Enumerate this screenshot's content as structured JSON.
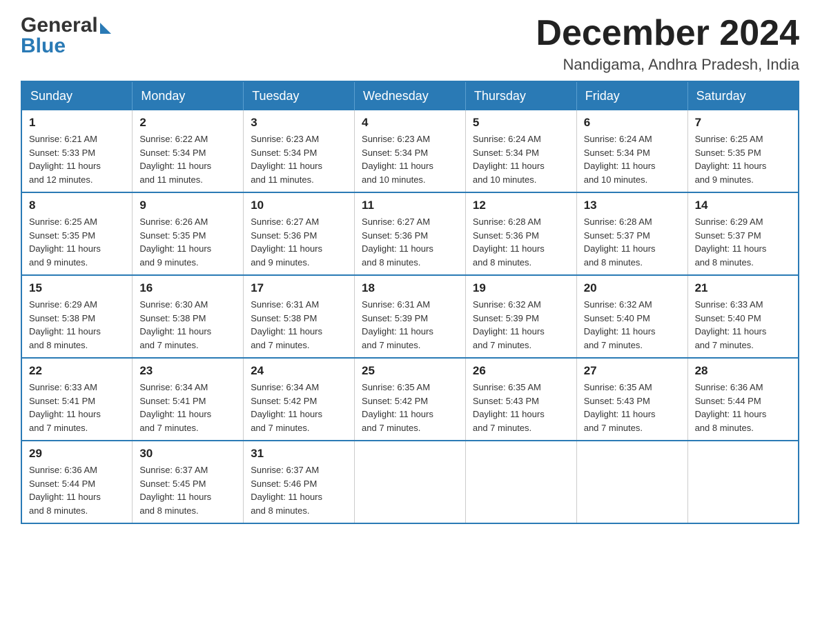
{
  "header": {
    "logo_general": "General",
    "logo_blue": "Blue",
    "month_title": "December 2024",
    "location": "Nandigama, Andhra Pradesh, India"
  },
  "days_of_week": [
    "Sunday",
    "Monday",
    "Tuesday",
    "Wednesday",
    "Thursday",
    "Friday",
    "Saturday"
  ],
  "weeks": [
    [
      {
        "day": "1",
        "sunrise": "6:21 AM",
        "sunset": "5:33 PM",
        "daylight": "11 hours and 12 minutes."
      },
      {
        "day": "2",
        "sunrise": "6:22 AM",
        "sunset": "5:34 PM",
        "daylight": "11 hours and 11 minutes."
      },
      {
        "day": "3",
        "sunrise": "6:23 AM",
        "sunset": "5:34 PM",
        "daylight": "11 hours and 11 minutes."
      },
      {
        "day": "4",
        "sunrise": "6:23 AM",
        "sunset": "5:34 PM",
        "daylight": "11 hours and 10 minutes."
      },
      {
        "day": "5",
        "sunrise": "6:24 AM",
        "sunset": "5:34 PM",
        "daylight": "11 hours and 10 minutes."
      },
      {
        "day": "6",
        "sunrise": "6:24 AM",
        "sunset": "5:34 PM",
        "daylight": "11 hours and 10 minutes."
      },
      {
        "day": "7",
        "sunrise": "6:25 AM",
        "sunset": "5:35 PM",
        "daylight": "11 hours and 9 minutes."
      }
    ],
    [
      {
        "day": "8",
        "sunrise": "6:25 AM",
        "sunset": "5:35 PM",
        "daylight": "11 hours and 9 minutes."
      },
      {
        "day": "9",
        "sunrise": "6:26 AM",
        "sunset": "5:35 PM",
        "daylight": "11 hours and 9 minutes."
      },
      {
        "day": "10",
        "sunrise": "6:27 AM",
        "sunset": "5:36 PM",
        "daylight": "11 hours and 9 minutes."
      },
      {
        "day": "11",
        "sunrise": "6:27 AM",
        "sunset": "5:36 PM",
        "daylight": "11 hours and 8 minutes."
      },
      {
        "day": "12",
        "sunrise": "6:28 AM",
        "sunset": "5:36 PM",
        "daylight": "11 hours and 8 minutes."
      },
      {
        "day": "13",
        "sunrise": "6:28 AM",
        "sunset": "5:37 PM",
        "daylight": "11 hours and 8 minutes."
      },
      {
        "day": "14",
        "sunrise": "6:29 AM",
        "sunset": "5:37 PM",
        "daylight": "11 hours and 8 minutes."
      }
    ],
    [
      {
        "day": "15",
        "sunrise": "6:29 AM",
        "sunset": "5:38 PM",
        "daylight": "11 hours and 8 minutes."
      },
      {
        "day": "16",
        "sunrise": "6:30 AM",
        "sunset": "5:38 PM",
        "daylight": "11 hours and 7 minutes."
      },
      {
        "day": "17",
        "sunrise": "6:31 AM",
        "sunset": "5:38 PM",
        "daylight": "11 hours and 7 minutes."
      },
      {
        "day": "18",
        "sunrise": "6:31 AM",
        "sunset": "5:39 PM",
        "daylight": "11 hours and 7 minutes."
      },
      {
        "day": "19",
        "sunrise": "6:32 AM",
        "sunset": "5:39 PM",
        "daylight": "11 hours and 7 minutes."
      },
      {
        "day": "20",
        "sunrise": "6:32 AM",
        "sunset": "5:40 PM",
        "daylight": "11 hours and 7 minutes."
      },
      {
        "day": "21",
        "sunrise": "6:33 AM",
        "sunset": "5:40 PM",
        "daylight": "11 hours and 7 minutes."
      }
    ],
    [
      {
        "day": "22",
        "sunrise": "6:33 AM",
        "sunset": "5:41 PM",
        "daylight": "11 hours and 7 minutes."
      },
      {
        "day": "23",
        "sunrise": "6:34 AM",
        "sunset": "5:41 PM",
        "daylight": "11 hours and 7 minutes."
      },
      {
        "day": "24",
        "sunrise": "6:34 AM",
        "sunset": "5:42 PM",
        "daylight": "11 hours and 7 minutes."
      },
      {
        "day": "25",
        "sunrise": "6:35 AM",
        "sunset": "5:42 PM",
        "daylight": "11 hours and 7 minutes."
      },
      {
        "day": "26",
        "sunrise": "6:35 AM",
        "sunset": "5:43 PM",
        "daylight": "11 hours and 7 minutes."
      },
      {
        "day": "27",
        "sunrise": "6:35 AM",
        "sunset": "5:43 PM",
        "daylight": "11 hours and 7 minutes."
      },
      {
        "day": "28",
        "sunrise": "6:36 AM",
        "sunset": "5:44 PM",
        "daylight": "11 hours and 8 minutes."
      }
    ],
    [
      {
        "day": "29",
        "sunrise": "6:36 AM",
        "sunset": "5:44 PM",
        "daylight": "11 hours and 8 minutes."
      },
      {
        "day": "30",
        "sunrise": "6:37 AM",
        "sunset": "5:45 PM",
        "daylight": "11 hours and 8 minutes."
      },
      {
        "day": "31",
        "sunrise": "6:37 AM",
        "sunset": "5:46 PM",
        "daylight": "11 hours and 8 minutes."
      },
      null,
      null,
      null,
      null
    ]
  ],
  "labels": {
    "sunrise": "Sunrise:",
    "sunset": "Sunset:",
    "daylight": "Daylight:"
  }
}
